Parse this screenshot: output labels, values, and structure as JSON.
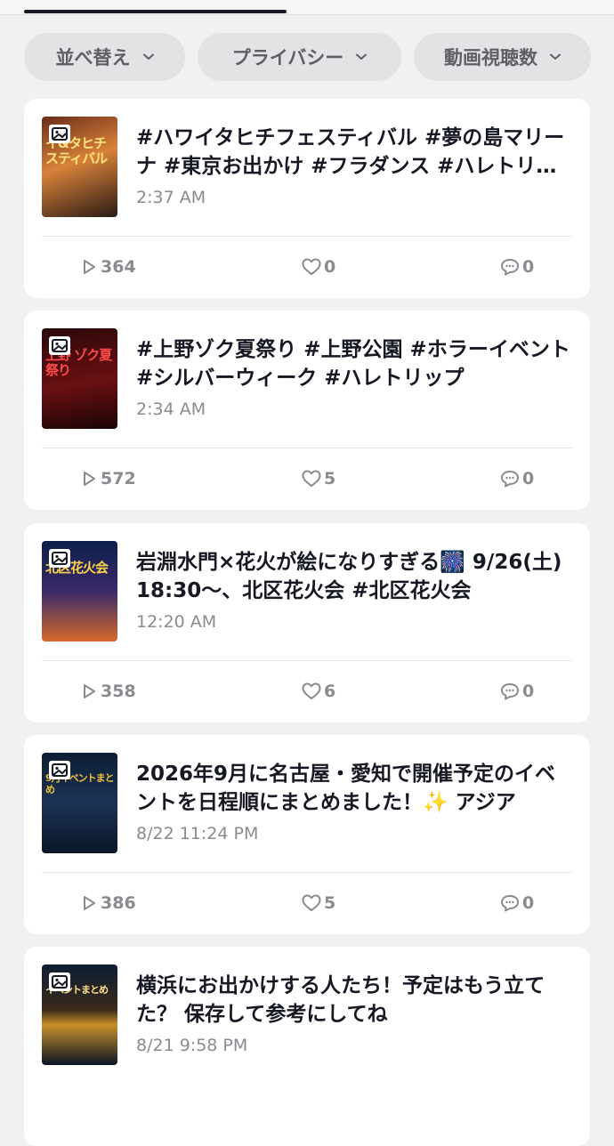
{
  "filters": [
    {
      "label": "並べ替え"
    },
    {
      "label": "プライバシー"
    },
    {
      "label": "動画視聴数"
    }
  ],
  "posts": [
    {
      "title": "#ハワイタヒチフェスティバル #夢の島マリーナ #東京お出かけ #フラダンス #ハレトリップ",
      "time": "2:37 AM",
      "thumb_text": "イ&タヒチ スティバル",
      "views": "364",
      "likes": "0",
      "comments": "0",
      "thumb_colors": [
        "#6b2c18",
        "#d8823a",
        "#2a1a14"
      ]
    },
    {
      "title": "#上野ゾク夏祭り #上野公園 #ホラーイベント #シルバーウィーク #ハレトリップ",
      "time": "2:34 AM",
      "thumb_text": "上野 ゾク夏祭り",
      "views": "572",
      "likes": "5",
      "comments": "0",
      "thumb_colors": [
        "#2a0708",
        "#6a1012",
        "#1a0405"
      ]
    },
    {
      "title": "岩淵水門×花火が絵になりすぎる🎆 9/26(土)18:30〜、北区花火会 #北区花火会",
      "time": "12:20 AM",
      "thumb_text": "北区花火会",
      "views": "358",
      "likes": "6",
      "comments": "0",
      "thumb_colors": [
        "#0c1f4a",
        "#3a2a6a",
        "#d46a2a"
      ]
    },
    {
      "title": "2026年9月に名古屋・愛知で開催予定のイベントを日程順にまとめました！✨ アジア",
      "time": "8/22 11:24 PM",
      "thumb_text": "9月イベントまとめ",
      "views": "386",
      "likes": "5",
      "comments": "0",
      "thumb_colors": [
        "#0d1d33",
        "#1c3355",
        "#0a1526"
      ]
    },
    {
      "title": "横浜にお出かけする人たち！予定はもう立てた？ 保存して参考にしてね",
      "time": "8/21 9:58 PM",
      "thumb_text": "イベントまとめ",
      "views": "",
      "likes": "",
      "comments": "",
      "thumb_colors": [
        "#0d1d33",
        "#c8902a",
        "#0a1526"
      ]
    }
  ]
}
